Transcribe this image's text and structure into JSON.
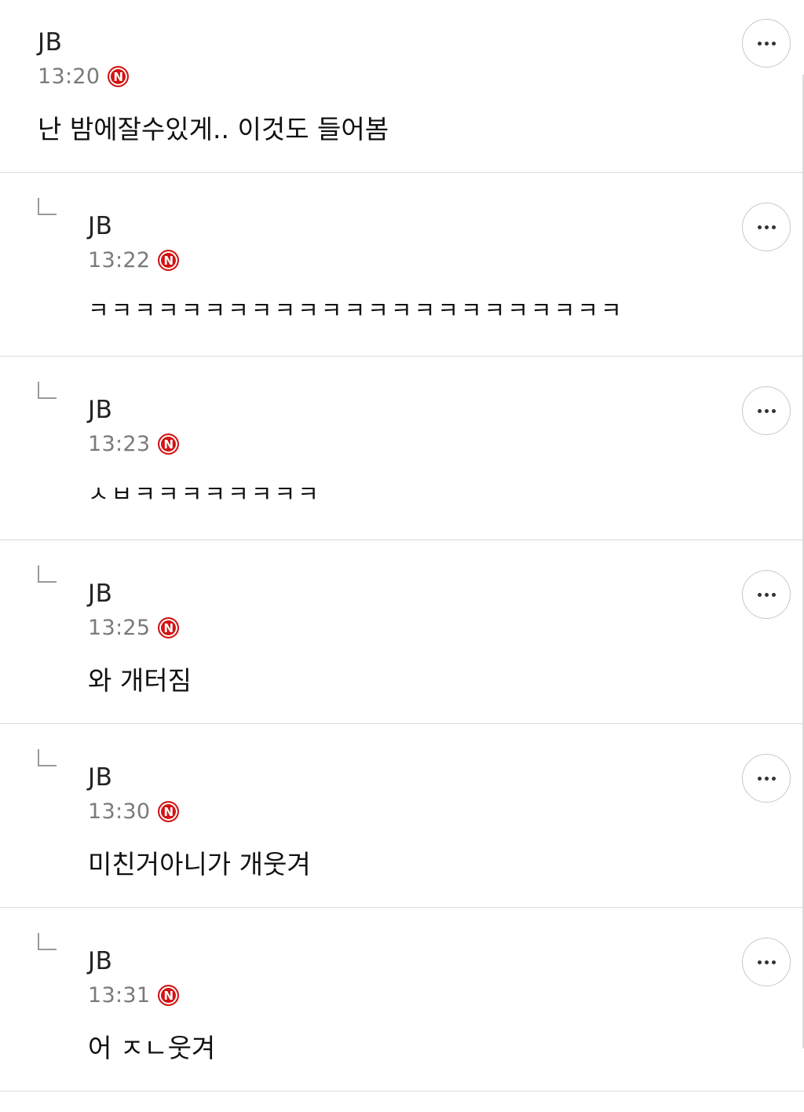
{
  "comments": [
    {
      "author": "JB",
      "time": "13:20",
      "badge": "N",
      "text": "난 밤에잘수있게.. 이것도 들어봄",
      "is_reply": false
    },
    {
      "author": "JB",
      "time": "13:22",
      "badge": "N",
      "text": "ㅋㅋㅋㅋㅋㅋㅋㅋㅋㅋㅋㅋㅋㅋㅋㅋㅋㅋㅋㅋㅋㅋㅋ",
      "is_reply": true
    },
    {
      "author": "JB",
      "time": "13:23",
      "badge": "N",
      "text": "ㅅㅂㅋㅋㅋㅋㅋㅋㅋㅋ",
      "is_reply": true
    },
    {
      "author": "JB",
      "time": "13:25",
      "badge": "N",
      "text": "와 개터짐",
      "is_reply": true
    },
    {
      "author": "JB",
      "time": "13:30",
      "badge": "N",
      "text": "미친거아니가 개웃겨",
      "is_reply": true
    },
    {
      "author": "JB",
      "time": "13:31",
      "badge": "N",
      "text": "어 ㅈㄴ웃겨",
      "is_reply": true
    }
  ],
  "icons": {
    "more": "more-options-icon",
    "reply": "reply-arrow-icon",
    "badge": "new-badge-icon"
  },
  "colors": {
    "badge": "#d21414",
    "time": "#7a7a7a",
    "divider": "#dcdcdc"
  }
}
